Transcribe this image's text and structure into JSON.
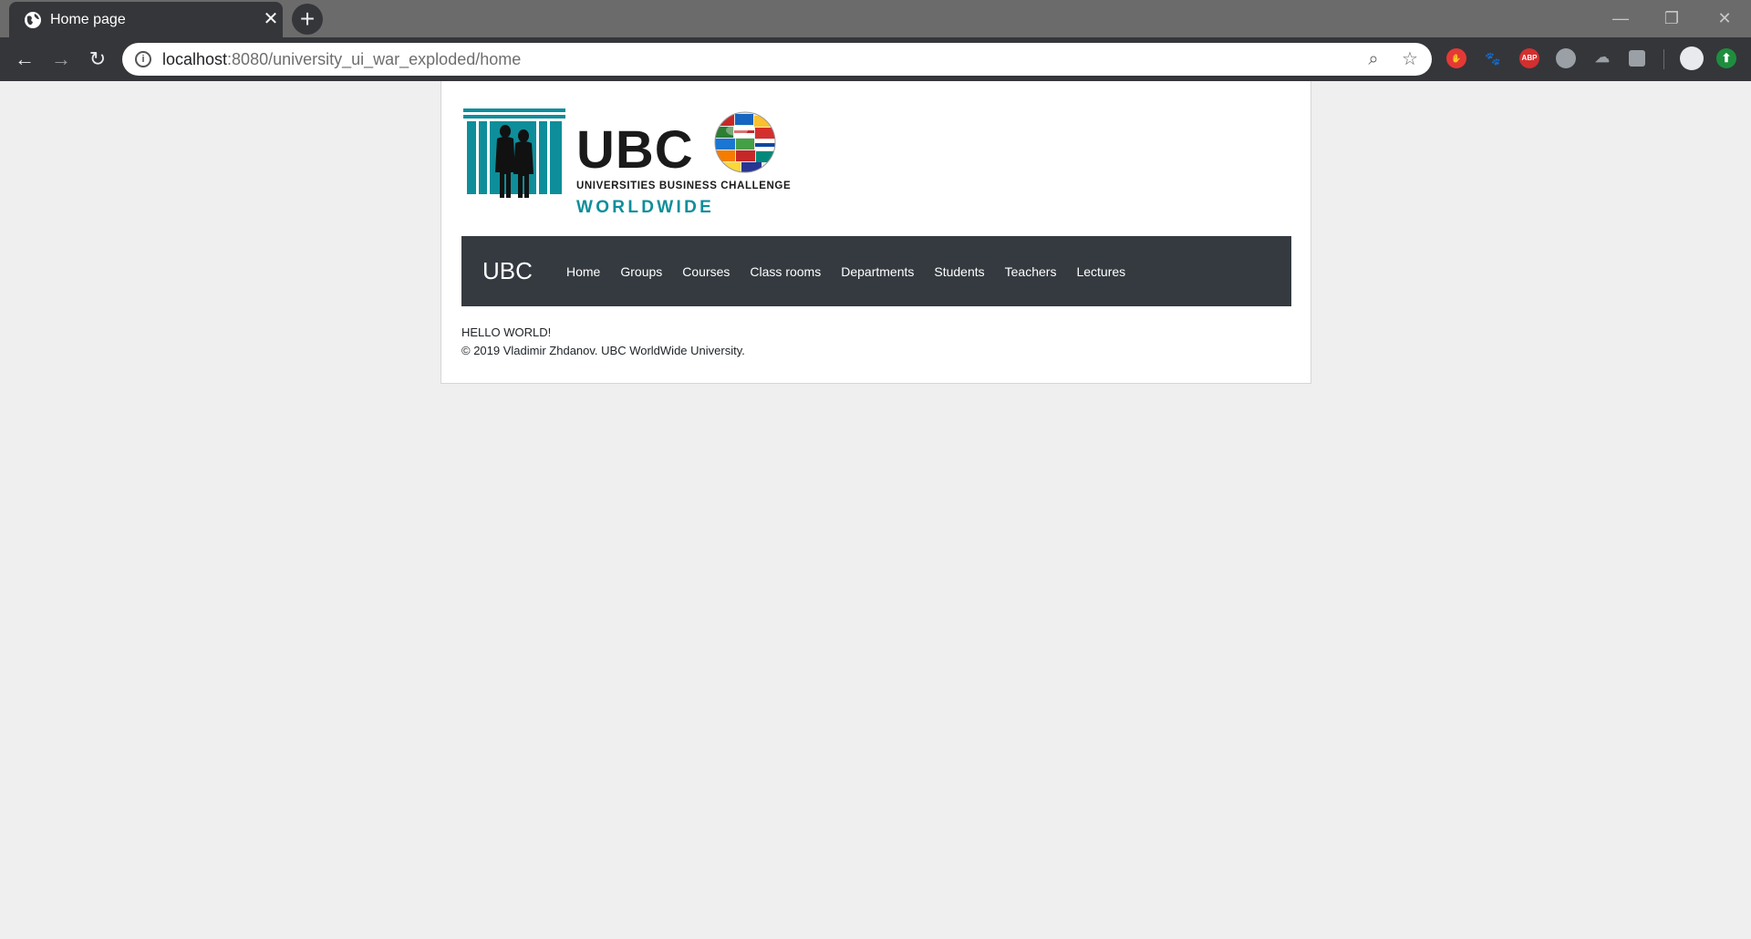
{
  "browser": {
    "tab_title": "Home page",
    "url_host": "localhost",
    "url_rest": ":8080/university_ui_war_exploded/home",
    "extensions": [
      "hand-icon",
      "paw-icon",
      "ABP",
      "globe-icon",
      "cloud-icon",
      "translate-icon",
      "profile-avatar",
      "upload-icon"
    ]
  },
  "logo": {
    "title": "UBC",
    "subtitle": "UNIVERSITIES BUSINESS CHALLENGE",
    "tagline": "WORLDWIDE"
  },
  "nav": {
    "brand": "UBC",
    "links": [
      "Home",
      "Groups",
      "Courses",
      "Class rooms",
      "Departments",
      "Students",
      "Teachers",
      "Lectures"
    ]
  },
  "content": {
    "greeting": "HELLO WORLD!",
    "footer": "© 2019 Vladimir Zhdanov. UBC WorldWide University."
  },
  "colors": {
    "navbar": "#343a40",
    "brand_teal": "#0e8e9a"
  }
}
